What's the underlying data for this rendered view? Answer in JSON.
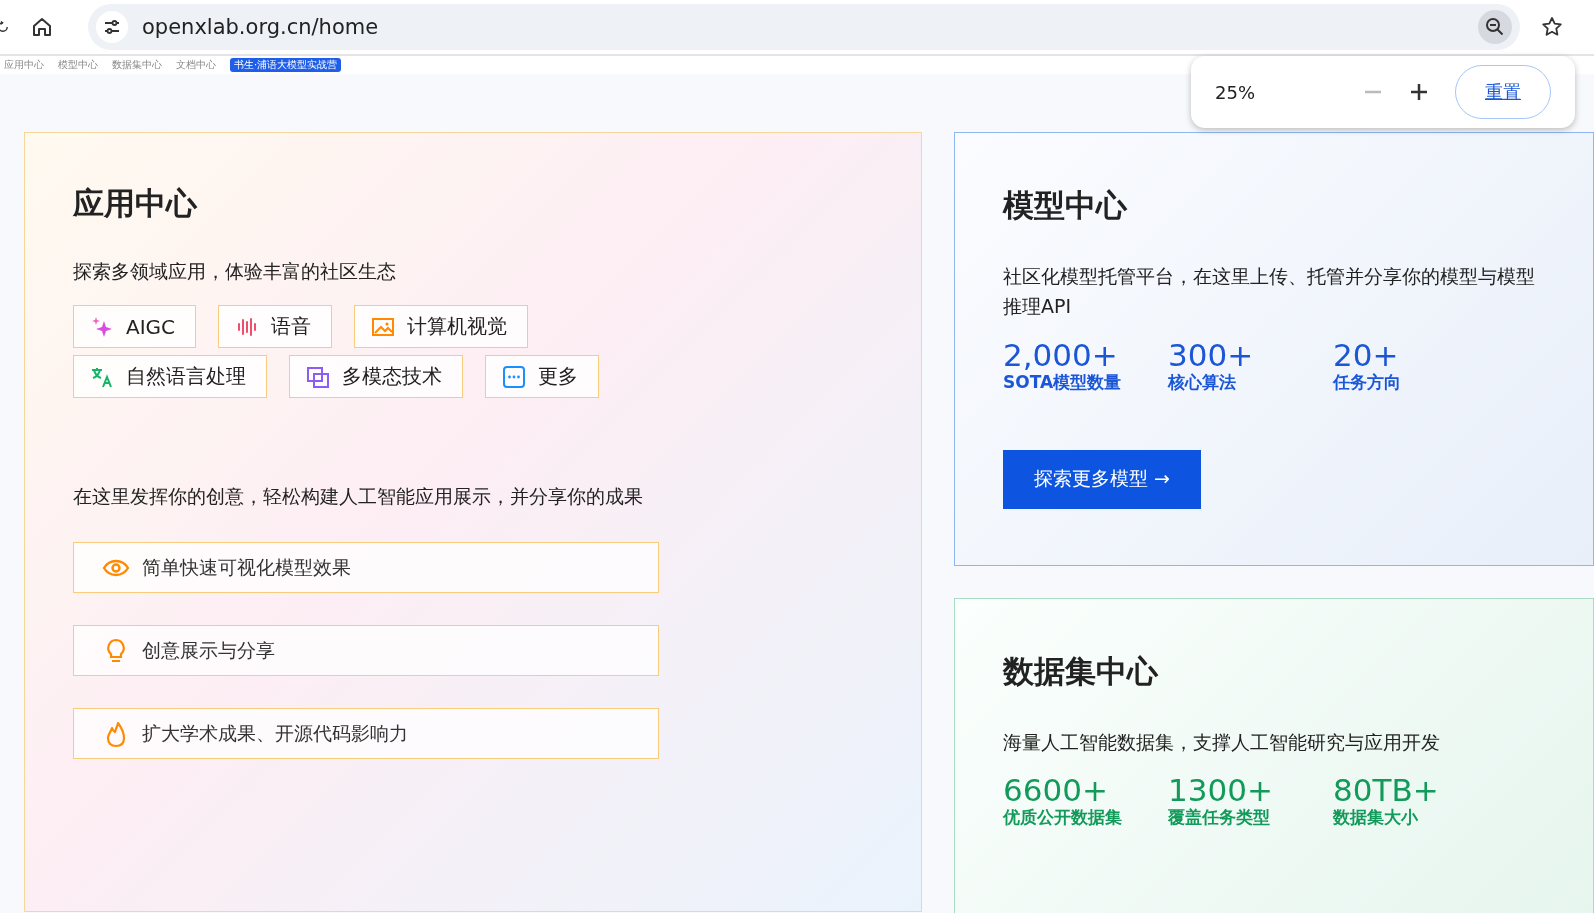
{
  "browser": {
    "url": "openxlab.org.cn/home"
  },
  "zoom_popup": {
    "value": "25%",
    "reset": "重置"
  },
  "nav": [
    {
      "label": "应用中心",
      "kind": "link"
    },
    {
      "label": "模型中心",
      "kind": "link"
    },
    {
      "label": "数据集中心",
      "kind": "link"
    },
    {
      "label": "文档中心",
      "kind": "link"
    },
    {
      "label": "书生·浦语大模型实战营",
      "kind": "badge"
    }
  ],
  "app_center": {
    "title": "应用中心",
    "subtitle": "探索多领域应用，体验丰富的社区生态",
    "tags": [
      {
        "label": "AIGC",
        "kind": "sparkle"
      },
      {
        "label": "语音",
        "kind": "audio"
      },
      {
        "label": "计算机视觉",
        "kind": "image"
      },
      {
        "label": "自然语言处理",
        "kind": "translate"
      },
      {
        "label": "多模态技术",
        "kind": "multimodal"
      },
      {
        "label": "更多",
        "kind": "more"
      }
    ],
    "description": "在这里发挥你的创意，轻松构建人工智能应用展示，并分享你的成果",
    "features": [
      {
        "label": "简单快速可视化模型效果",
        "kind": "eye"
      },
      {
        "label": "创意展示与分享",
        "kind": "bulb"
      },
      {
        "label": "扩大学术成果、开源代码影响力",
        "kind": "flame"
      }
    ]
  },
  "model_center": {
    "title": "模型中心",
    "description": "社区化模型托管平台，在这里上传、托管并分享你的模型与模型推理API",
    "stats": [
      {
        "value": "2,000+",
        "label": "SOTA模型数量"
      },
      {
        "value": "300+",
        "label": "核心算法"
      },
      {
        "value": "20+",
        "label": "任务方向"
      }
    ],
    "button": "探索更多模型 →"
  },
  "dataset_center": {
    "title": "数据集中心",
    "description": "海量人工智能数据集，支撑人工智能研究与应用开发",
    "stats": [
      {
        "value": "6600+",
        "label": "优质公开数据集"
      },
      {
        "value": "1300+",
        "label": "覆盖任务类型"
      },
      {
        "value": "80TB+",
        "label": "数据集大小"
      }
    ]
  }
}
